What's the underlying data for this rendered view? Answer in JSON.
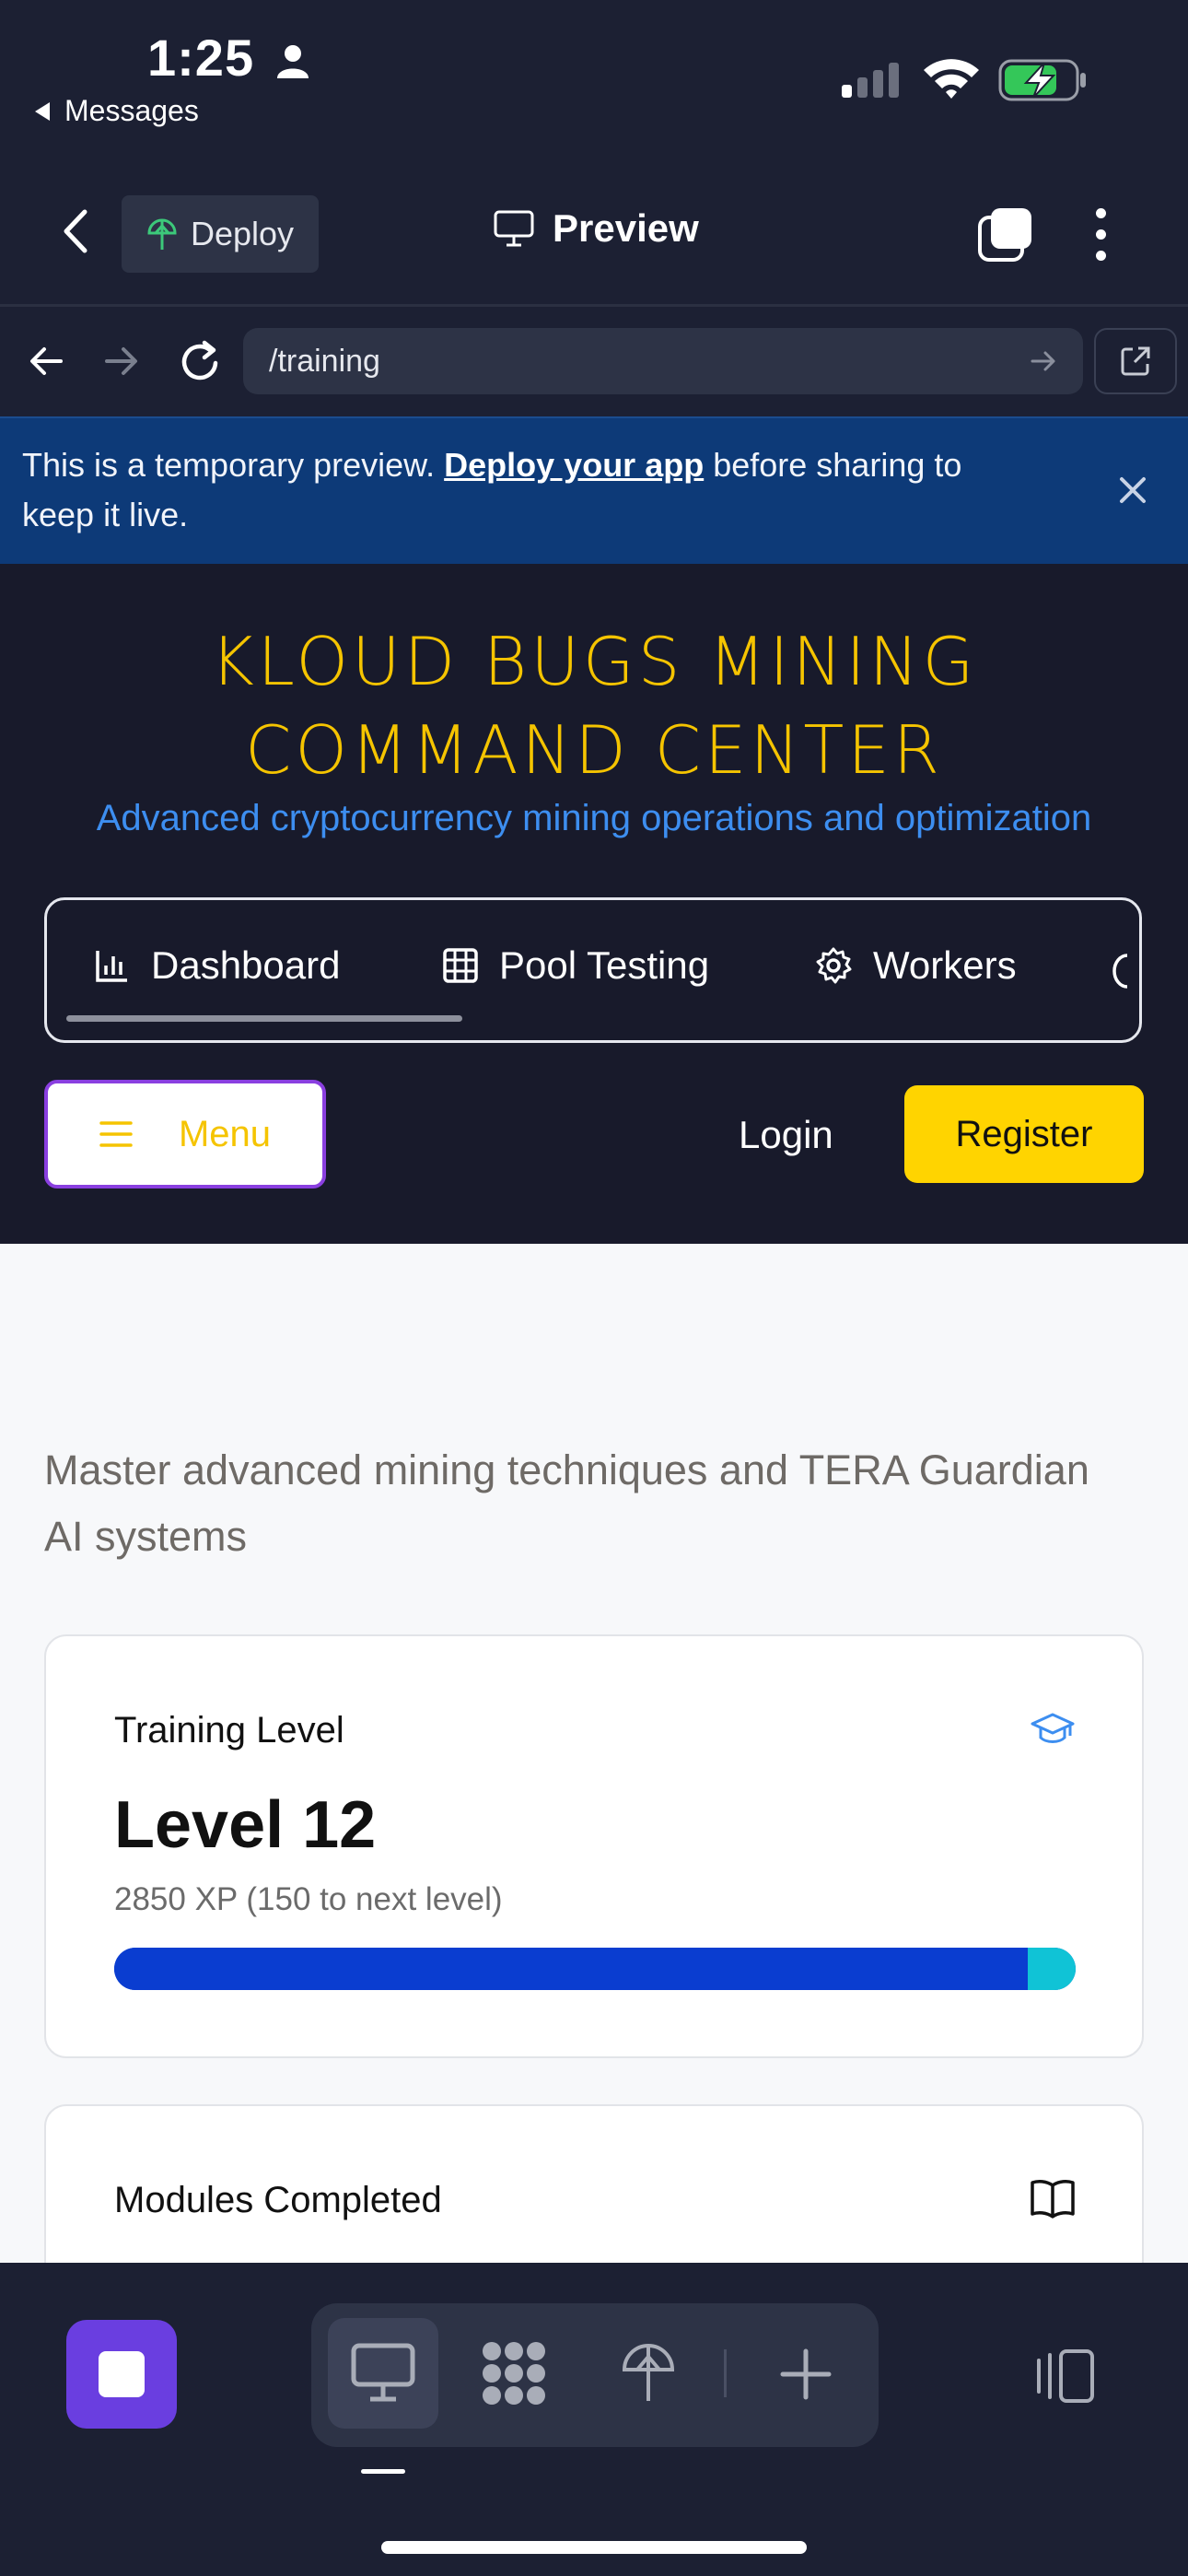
{
  "status_bar": {
    "time": "1:25",
    "back_app": "Messages",
    "battery_color": "#34c759"
  },
  "header": {
    "deploy_label": "Deploy",
    "preview_label": "Preview"
  },
  "browser": {
    "url": "/training"
  },
  "banner": {
    "text_before": "This is a temporary preview. ",
    "link_text": "Deploy your app",
    "text_after": " before sharing to keep it live."
  },
  "app": {
    "title_line1": "KLOUD BUGS MINING",
    "title_line2": "COMMAND CENTER",
    "subtitle": "Advanced cryptocurrency mining operations and optimization",
    "tabs": [
      {
        "label": "Dashboard",
        "icon": "bar-chart-icon"
      },
      {
        "label": "Pool Testing",
        "icon": "grid-icon"
      },
      {
        "label": "Workers",
        "icon": "gear-icon"
      }
    ],
    "menu_label": "Menu",
    "login_label": "Login",
    "register_label": "Register",
    "accent_color": "#f5c400"
  },
  "content": {
    "intro": "Master advanced mining techniques and TERA Guardian AI systems",
    "training_card": {
      "label": "Training Level",
      "value": "Level 12",
      "xp_text": "2850 XP (150 to next level)",
      "progress": 0.95
    },
    "modules_card": {
      "label": "Modules Completed"
    }
  },
  "toolbar": {
    "icons": [
      "stop-icon",
      "desktop-icon",
      "apps-icon",
      "deploy-icon",
      "plus-icon",
      "panels-icon"
    ]
  }
}
